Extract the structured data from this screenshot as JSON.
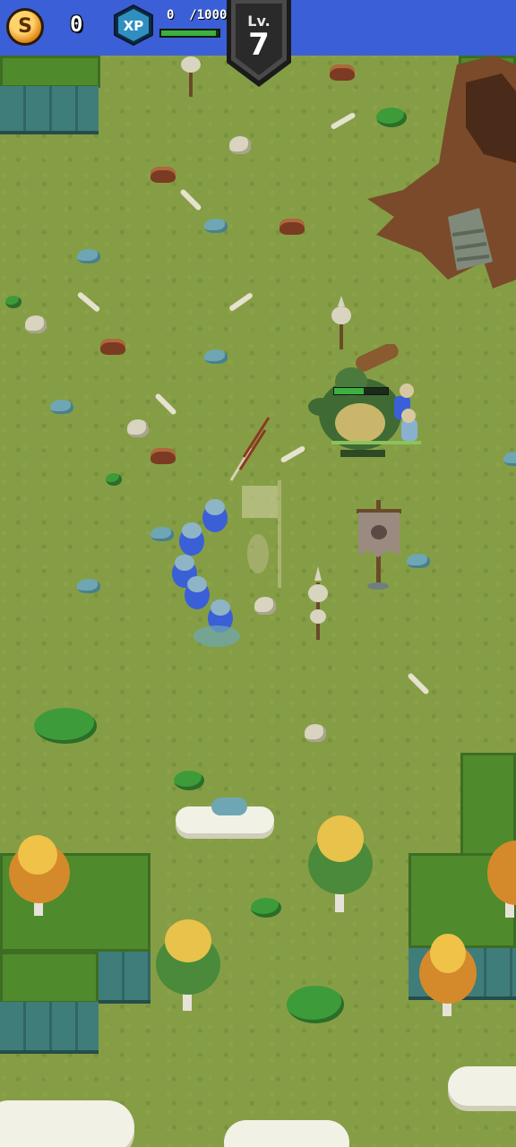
{
  "hud": {
    "coins": "0",
    "coin_symbol": "S",
    "xp_label": "XP",
    "xp_current": "0",
    "xp_max": "/1000",
    "xp_progress": 0.95,
    "level_label": "Lv.",
    "level_value": "7"
  },
  "scene": {
    "boss_health": 0.55
  },
  "colors": {
    "hud_bar": "#3b5fd6",
    "grass": "#859e45",
    "xp_fill": "#3cb040"
  },
  "icons": [
    "coin-icon",
    "xp-icon",
    "level-shield-icon"
  ]
}
